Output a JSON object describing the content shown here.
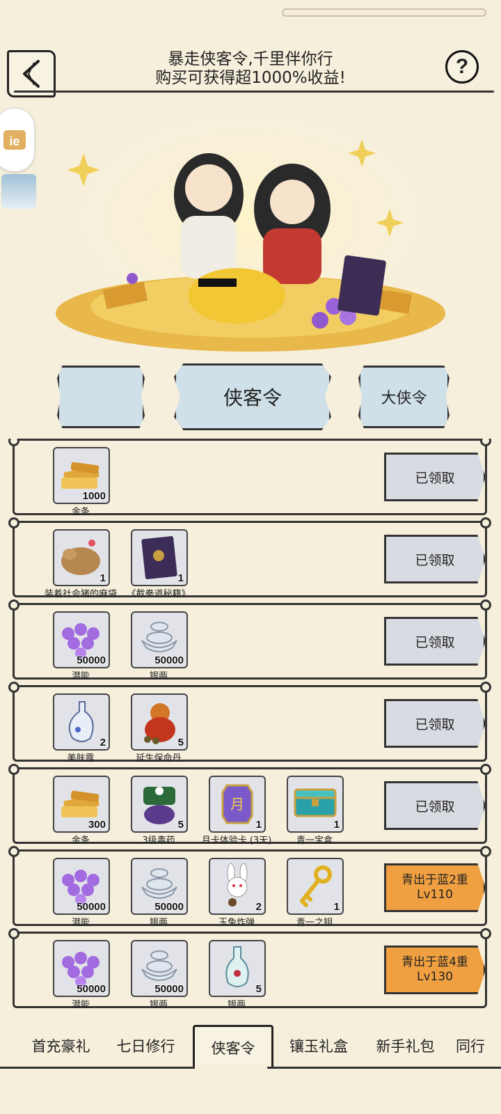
{
  "header": {
    "title_line1": "暴走侠客令,千里伴你行",
    "title_line2": "购买可获得超1000%收益!",
    "help_label": "?"
  },
  "tabs": [
    {
      "label": ""
    },
    {
      "label": "侠客令"
    },
    {
      "label": "大侠令"
    }
  ],
  "rewards": [
    {
      "items": [
        {
          "name": "金条",
          "count": "1000",
          "icon": "gold-bars-icon"
        }
      ],
      "button": "已领取"
    },
    {
      "items": [
        {
          "name": "装着社会猪的麻袋",
          "count": "1",
          "icon": "pig-sack-icon"
        },
        {
          "name": "《截拳道秘籍》",
          "count": "1",
          "icon": "book-icon"
        }
      ],
      "button": "已领取"
    },
    {
      "items": [
        {
          "name": "潜能",
          "count": "50000",
          "icon": "purple-pearls-icon"
        },
        {
          "name": "银两",
          "count": "50000",
          "icon": "silver-ingots-icon"
        }
      ],
      "button": "已领取"
    },
    {
      "items": [
        {
          "name": "美肤露",
          "count": "2",
          "icon": "lotion-bottle-icon"
        },
        {
          "name": "延生保命丹",
          "count": "5",
          "icon": "pill-gourd-icon"
        }
      ],
      "button": "已领取"
    },
    {
      "items": [
        {
          "name": "金条",
          "count": "300",
          "icon": "gold-bars-icon"
        },
        {
          "name": "3级毒药",
          "count": "5",
          "icon": "poison-icon"
        },
        {
          "name": "月卡体验卡 (3天)",
          "count": "1",
          "icon": "month-card-icon"
        },
        {
          "name": "青一宝盒",
          "count": "1",
          "icon": "treasure-chest-icon"
        }
      ],
      "button": "已领取"
    },
    {
      "items": [
        {
          "name": "潜能",
          "count": "50000",
          "icon": "purple-pearls-icon"
        },
        {
          "name": "银两",
          "count": "50000",
          "icon": "silver-ingots-icon"
        },
        {
          "name": "玉兔炸弹",
          "count": "2",
          "icon": "rabbit-bomb-icon"
        },
        {
          "name": "青一之钥",
          "count": "1",
          "icon": "gold-key-icon"
        }
      ],
      "button_line1": "青出于蓝2重",
      "button_line2": "Lv110"
    },
    {
      "items": [
        {
          "name": "潜能",
          "count": "50000",
          "icon": "purple-pearls-icon"
        },
        {
          "name": "银两",
          "count": "50000",
          "icon": "silver-ingots-icon"
        },
        {
          "name": "银两",
          "count": "5",
          "icon": "vase-icon"
        }
      ],
      "button_line1": "青出于蓝4重",
      "button_line2": "Lv130"
    }
  ],
  "bottom_nav": [
    {
      "label": "首充豪礼"
    },
    {
      "label": "七日修行"
    },
    {
      "label": "侠客令"
    },
    {
      "label": "镶玉礼盒"
    },
    {
      "label": "新手礼包"
    },
    {
      "label": "同行"
    }
  ],
  "colors": {
    "background": "#f6efdc",
    "tab_fill": "#cfe0e8",
    "claimed_button": "#d9dbe2",
    "level_button": "#f0a040"
  }
}
